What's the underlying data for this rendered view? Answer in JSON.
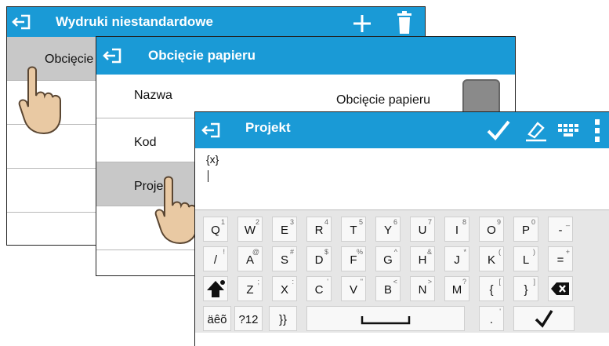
{
  "window1": {
    "title": "Wydruki niestandardowe",
    "row1": "Obcięcie"
  },
  "window2": {
    "title": "Obcięcie papieru",
    "rows": {
      "nazwa": "Nazwa",
      "nazwa_value": "Obcięcie papieru",
      "kod": "Kod",
      "projekt": "Projekt"
    }
  },
  "window3": {
    "title": "Projekt",
    "editor_text": "{x}"
  },
  "keyboard": {
    "row1": [
      {
        "main": "Q",
        "sup": "1"
      },
      {
        "main": "W",
        "sup": "2"
      },
      {
        "main": "E",
        "sup": "3"
      },
      {
        "main": "R",
        "sup": "4"
      },
      {
        "main": "T",
        "sup": "5"
      },
      {
        "main": "Y",
        "sup": "6"
      },
      {
        "main": "U",
        "sup": "7"
      },
      {
        "main": "I",
        "sup": "8"
      },
      {
        "main": "O",
        "sup": "9"
      },
      {
        "main": "P",
        "sup": "0"
      },
      {
        "main": "-",
        "sup": "_"
      }
    ],
    "row2": [
      {
        "main": "/",
        "sup": "!"
      },
      {
        "main": "A",
        "sup": "@"
      },
      {
        "main": "S",
        "sup": "#"
      },
      {
        "main": "D",
        "sup": "$"
      },
      {
        "main": "F",
        "sup": "%"
      },
      {
        "main": "G",
        "sup": "^"
      },
      {
        "main": "H",
        "sup": "&"
      },
      {
        "main": "J",
        "sup": "*"
      },
      {
        "main": "K",
        "sup": "("
      },
      {
        "main": "L",
        "sup": ")"
      },
      {
        "main": "=",
        "sup": "+"
      }
    ],
    "row3": [
      {
        "main": "Z",
        "sup": ";"
      },
      {
        "main": "X",
        "sup": ":"
      },
      {
        "main": "C",
        "sup": "'"
      },
      {
        "main": "V",
        "sup": "\""
      },
      {
        "main": "B",
        "sup": "<"
      },
      {
        "main": "N",
        "sup": ">"
      },
      {
        "main": "M",
        "sup": "?"
      },
      {
        "main": "{",
        "sup": "["
      },
      {
        "main": "}",
        "sup": "]"
      }
    ],
    "special": {
      "accents": "äêõ",
      "numbers": "?12",
      "braces": "}}",
      "dot_key": ".",
      "apostrophe": "'"
    }
  },
  "colors": {
    "titlebar": "#1a9ad6",
    "selected_row": "#c8c8c8",
    "keyboard_bg": "#e6e6e6"
  },
  "icons": [
    "back-arrow-icon",
    "plus-icon",
    "trash-icon",
    "check-icon",
    "eraser-icon",
    "keyboard-icon",
    "more-vertical-icon",
    "shift-icon",
    "backspace-icon",
    "space-icon",
    "hand-pointer-icon"
  ]
}
